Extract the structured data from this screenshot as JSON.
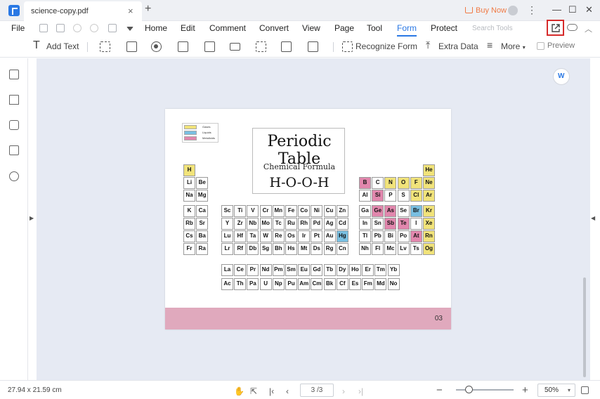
{
  "titlebar": {
    "tab_title": "science-copy.pdf",
    "tab_close": "×",
    "tab_add": "+",
    "buy_now": "Buy Now",
    "more_glyph": "⋮",
    "minimize": "—",
    "maximize": "☐",
    "close": "✕"
  },
  "menu": {
    "file": "File",
    "items": [
      "Home",
      "Edit",
      "Comment",
      "Convert",
      "View",
      "Page",
      "Tool",
      "Form",
      "Protect"
    ],
    "active": "Form",
    "search_placeholder": "Search Tools"
  },
  "toolbar": {
    "add_text": "Add Text",
    "recognize_form": "Recognize Form",
    "extra_data": "Extra Data",
    "more": "More",
    "preview": "Preview"
  },
  "document": {
    "legend": [
      "Gases",
      "Liquids",
      "Metalloids"
    ],
    "title": "Periodic Table",
    "subtitle": "Chemical Formula",
    "formula": "H-O-O-H",
    "page_label": "03",
    "elements": [
      {
        "s": "H",
        "t": "g"
      },
      {
        "s": "He",
        "t": "g"
      },
      {
        "s": "Li",
        "t": "n"
      },
      {
        "s": "Be",
        "t": "n"
      },
      {
        "s": "B",
        "t": "m"
      },
      {
        "s": "C",
        "t": "n"
      },
      {
        "s": "N",
        "t": "g"
      },
      {
        "s": "O",
        "t": "g"
      },
      {
        "s": "F",
        "t": "g"
      },
      {
        "s": "Ne",
        "t": "g"
      },
      {
        "s": "Na",
        "t": "n"
      },
      {
        "s": "Mg",
        "t": "n"
      },
      {
        "s": "Al",
        "t": "n"
      },
      {
        "s": "Si",
        "t": "m"
      },
      {
        "s": "P",
        "t": "n"
      },
      {
        "s": "S",
        "t": "n"
      },
      {
        "s": "Cl",
        "t": "g"
      },
      {
        "s": "Ar",
        "t": "g"
      },
      {
        "s": "K",
        "t": "n"
      },
      {
        "s": "Ca",
        "t": "n"
      },
      {
        "s": "Sc",
        "t": "n"
      },
      {
        "s": "Ti",
        "t": "n"
      },
      {
        "s": "V",
        "t": "n"
      },
      {
        "s": "Cr",
        "t": "n"
      },
      {
        "s": "Mn",
        "t": "n"
      },
      {
        "s": "Fe",
        "t": "n"
      },
      {
        "s": "Co",
        "t": "n"
      },
      {
        "s": "Ni",
        "t": "n"
      },
      {
        "s": "Cu",
        "t": "n"
      },
      {
        "s": "Zn",
        "t": "n"
      },
      {
        "s": "Ga",
        "t": "n"
      },
      {
        "s": "Ge",
        "t": "m"
      },
      {
        "s": "As",
        "t": "m"
      },
      {
        "s": "Se",
        "t": "n"
      },
      {
        "s": "Br",
        "t": "l"
      },
      {
        "s": "Kr",
        "t": "g"
      },
      {
        "s": "Rb",
        "t": "n"
      },
      {
        "s": "Sr",
        "t": "n"
      },
      {
        "s": "Y",
        "t": "n"
      },
      {
        "s": "Zr",
        "t": "n"
      },
      {
        "s": "Nb",
        "t": "n"
      },
      {
        "s": "Mo",
        "t": "n"
      },
      {
        "s": "Tc",
        "t": "n"
      },
      {
        "s": "Ru",
        "t": "n"
      },
      {
        "s": "Rh",
        "t": "n"
      },
      {
        "s": "Pd",
        "t": "n"
      },
      {
        "s": "Ag",
        "t": "n"
      },
      {
        "s": "Cd",
        "t": "n"
      },
      {
        "s": "In",
        "t": "n"
      },
      {
        "s": "Sn",
        "t": "n"
      },
      {
        "s": "Sb",
        "t": "m"
      },
      {
        "s": "Te",
        "t": "m"
      },
      {
        "s": "I",
        "t": "n"
      },
      {
        "s": "Xe",
        "t": "g"
      },
      {
        "s": "Cs",
        "t": "n"
      },
      {
        "s": "Ba",
        "t": "n"
      },
      {
        "s": "Lu",
        "t": "n"
      },
      {
        "s": "Hf",
        "t": "n"
      },
      {
        "s": "Ta",
        "t": "n"
      },
      {
        "s": "W",
        "t": "n"
      },
      {
        "s": "Re",
        "t": "n"
      },
      {
        "s": "Os",
        "t": "n"
      },
      {
        "s": "Ir",
        "t": "n"
      },
      {
        "s": "Pt",
        "t": "n"
      },
      {
        "s": "Au",
        "t": "n"
      },
      {
        "s": "Hg",
        "t": "l"
      },
      {
        "s": "Tl",
        "t": "n"
      },
      {
        "s": "Pb",
        "t": "n"
      },
      {
        "s": "Bi",
        "t": "n"
      },
      {
        "s": "Po",
        "t": "n"
      },
      {
        "s": "At",
        "t": "m"
      },
      {
        "s": "Rn",
        "t": "g"
      },
      {
        "s": "Fr",
        "t": "n"
      },
      {
        "s": "Ra",
        "t": "n"
      },
      {
        "s": "Lr",
        "t": "n"
      },
      {
        "s": "Rf",
        "t": "n"
      },
      {
        "s": "Db",
        "t": "n"
      },
      {
        "s": "Sg",
        "t": "n"
      },
      {
        "s": "Bh",
        "t": "n"
      },
      {
        "s": "Hs",
        "t": "n"
      },
      {
        "s": "Mt",
        "t": "n"
      },
      {
        "s": "Ds",
        "t": "n"
      },
      {
        "s": "Rg",
        "t": "n"
      },
      {
        "s": "Cn",
        "t": "n"
      },
      {
        "s": "Nh",
        "t": "n"
      },
      {
        "s": "Fl",
        "t": "n"
      },
      {
        "s": "Mc",
        "t": "n"
      },
      {
        "s": "Lv",
        "t": "n"
      },
      {
        "s": "Ts",
        "t": "n"
      },
      {
        "s": "Og",
        "t": "g"
      },
      {
        "s": "La",
        "t": "n"
      },
      {
        "s": "Ce",
        "t": "n"
      },
      {
        "s": "Pr",
        "t": "n"
      },
      {
        "s": "Nd",
        "t": "n"
      },
      {
        "s": "Pm",
        "t": "n"
      },
      {
        "s": "Sm",
        "t": "n"
      },
      {
        "s": "Eu",
        "t": "n"
      },
      {
        "s": "Gd",
        "t": "n"
      },
      {
        "s": "Tb",
        "t": "n"
      },
      {
        "s": "Dy",
        "t": "n"
      },
      {
        "s": "Ho",
        "t": "n"
      },
      {
        "s": "Er",
        "t": "n"
      },
      {
        "s": "Tm",
        "t": "n"
      },
      {
        "s": "Yb",
        "t": "n"
      },
      {
        "s": "Ac",
        "t": "n"
      },
      {
        "s": "Th",
        "t": "n"
      },
      {
        "s": "Pa",
        "t": "n"
      },
      {
        "s": "U",
        "t": "n"
      },
      {
        "s": "Np",
        "t": "n"
      },
      {
        "s": "Pu",
        "t": "n"
      },
      {
        "s": "Am",
        "t": "n"
      },
      {
        "s": "Cm",
        "t": "n"
      },
      {
        "s": "Bk",
        "t": "n"
      },
      {
        "s": "Cf",
        "t": "n"
      },
      {
        "s": "Es",
        "t": "n"
      },
      {
        "s": "Fm",
        "t": "n"
      },
      {
        "s": "Md",
        "t": "n"
      },
      {
        "s": "No",
        "t": "n"
      }
    ]
  },
  "status": {
    "page_size": "27.94 x 21.59 cm",
    "page_indicator": "3 /3",
    "zoom_minus": "−",
    "zoom_plus": "+",
    "zoom_level_fraction": 0.22,
    "zoom_value": "50%"
  },
  "colors": {
    "accent": "#2a78e4",
    "highlight_border": "#d62b2b",
    "gas": "#f1e37a",
    "liquid": "#79bfe1",
    "metalloid": "#e187ad",
    "footer": "#e0a9bd"
  }
}
